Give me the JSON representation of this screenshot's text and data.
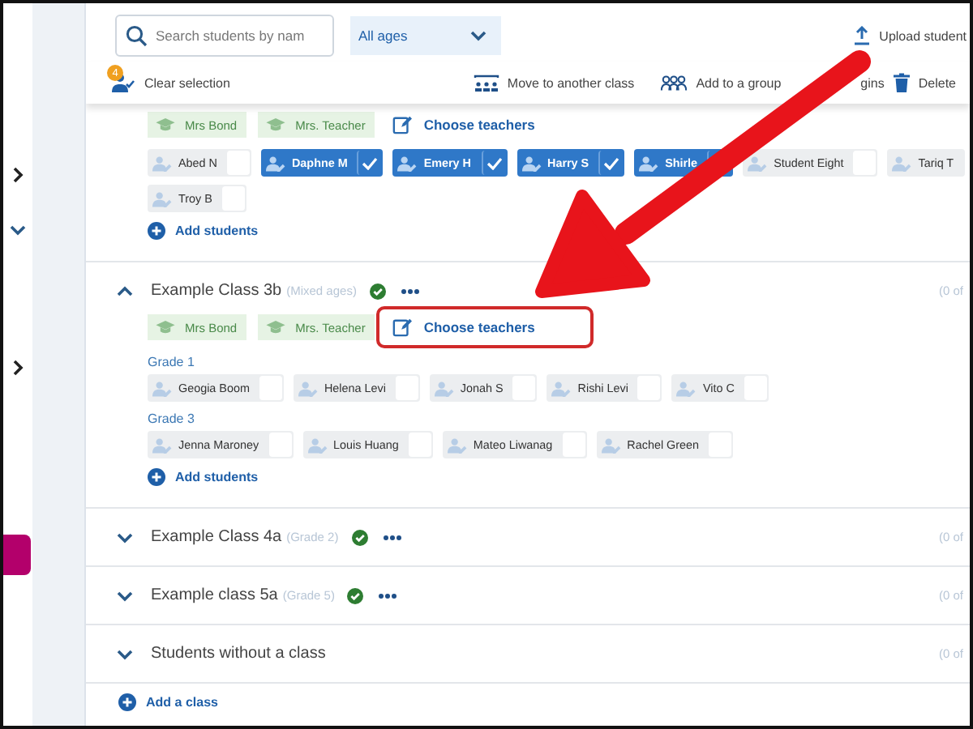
{
  "sidebar": {
    "chevrons": [
      {
        "expanded": false
      },
      {
        "expanded": true
      },
      {
        "expanded": false
      }
    ]
  },
  "search": {
    "placeholder": "Search students by nam"
  },
  "age_filter": {
    "value": "All ages"
  },
  "upload": {
    "label": "Upload student"
  },
  "selection": {
    "count": "4",
    "label": "Clear selection"
  },
  "actions": [
    {
      "kind": "move",
      "label": "Move to another class"
    },
    {
      "kind": "group",
      "label": "Add to a group"
    },
    {
      "kind": "logins",
      "label": "gins"
    },
    {
      "kind": "delete",
      "label": "Delete"
    }
  ],
  "classes": [
    {
      "teachers": [
        "Mrs Bond",
        "Mrs. Teacher"
      ],
      "choose_label": "Choose teachers",
      "choose_highlighted": false,
      "groups": [
        {
          "students": [
            {
              "name": "Abed N",
              "checked": false
            },
            {
              "name": "Daphne M",
              "checked": true
            },
            {
              "name": "Emery H",
              "checked": true
            },
            {
              "name": "Harry S",
              "checked": true
            },
            {
              "name": "Shirle",
              "checked": true
            },
            {
              "name": "Student Eight",
              "checked": false
            },
            {
              "name": "Tariq T"
            },
            {
              "name": "Troy B",
              "checked": false
            }
          ]
        }
      ],
      "add_label": "Add students"
    },
    {
      "name": "Example Class 3b",
      "age": "(Mixed ages)",
      "verified": true,
      "count": "(0 of",
      "expanded": true,
      "teachers": [
        "Mrs Bond",
        "Mrs. Teacher"
      ],
      "choose_label": "Choose teachers",
      "choose_highlighted": true,
      "groups": [
        {
          "label": "Grade 1",
          "students": [
            {
              "name": "Geogia Boom",
              "checked": false
            },
            {
              "name": "Helena Levi",
              "checked": false
            },
            {
              "name": "Jonah S",
              "checked": false
            },
            {
              "name": "Rishi Levi",
              "checked": false
            },
            {
              "name": "Vito C",
              "checked": false
            }
          ]
        },
        {
          "label": "Grade 3",
          "students": [
            {
              "name": "Jenna Maroney",
              "checked": false
            },
            {
              "name": "Louis Huang",
              "checked": false
            },
            {
              "name": "Mateo Liwanag",
              "checked": false
            },
            {
              "name": "Rachel Green",
              "checked": false
            }
          ]
        }
      ],
      "add_label": "Add students"
    },
    {
      "name": "Example Class 4a",
      "age": "(Grade 2)",
      "verified": true,
      "count": "(0 of",
      "expanded": false
    },
    {
      "name": "Example class 5a",
      "age": "(Grade 5)",
      "verified": true,
      "count": "(0 of",
      "expanded": false
    },
    {
      "name": "Students without a class",
      "verified": false,
      "count": "(0 of",
      "expanded": false
    }
  ],
  "add_class": "Add a class",
  "annotation_arrow": true
}
